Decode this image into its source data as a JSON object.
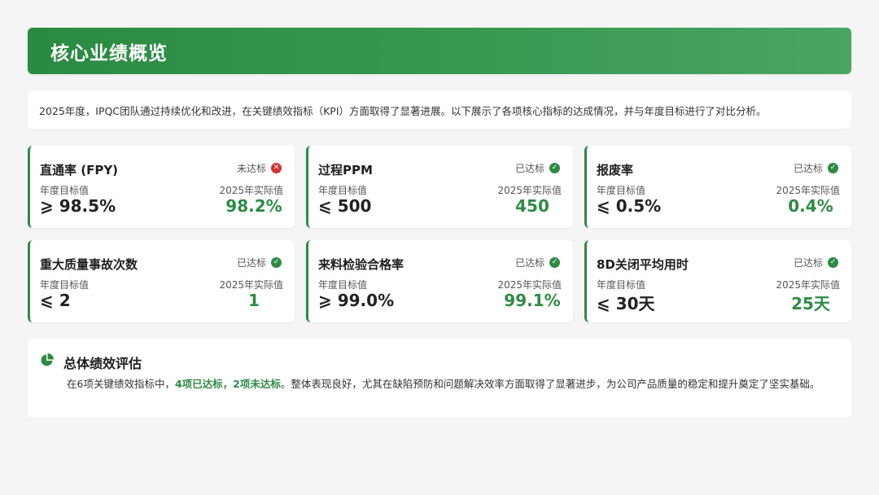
{
  "header": {
    "title": "核心业绩概览"
  },
  "intro": {
    "text": "2025年度，IPQC团队通过持续优化和改进，在关键绩效指标（KPI）方面取得了显著进展。以下展示了各项核心指标的达成情况，并与年度目标进行了对比分析。"
  },
  "labels": {
    "target": "年度目标值",
    "actual": "2025年实际值"
  },
  "kpis": [
    {
      "title": "直通率 (FPY)",
      "status": "未达标",
      "status_icon": "x-circle-icon",
      "target": "⩾ 98.5%",
      "actual": "98.2%"
    },
    {
      "title": "过程PPM",
      "status": "已达标",
      "status_icon": "check-circle-icon",
      "target": "⩽ 500",
      "actual": "450"
    },
    {
      "title": "报废率",
      "status": "已达标",
      "status_icon": "check-circle-icon",
      "target": "⩽ 0.5%",
      "actual": "0.4%"
    },
    {
      "title": "重大质量事故次数",
      "status": "已达标",
      "status_icon": "check-circle-icon",
      "target": "⩽ 2",
      "actual": "1"
    },
    {
      "title": "来料检验合格率",
      "status": "已达标",
      "status_icon": "check-circle-icon",
      "target": "⩾ 99.0%",
      "actual": "99.1%"
    },
    {
      "title": "8D关闭平均用时",
      "status": "已达标",
      "status_icon": "check-circle-icon",
      "target": "⩽ 30天",
      "actual": "25天"
    }
  ],
  "summary": {
    "title": "总体绩效评估",
    "icon": "pie-chart-icon",
    "text_before": "在6项关键绩效指标中，",
    "highlight": "4项已达标，2项未达标",
    "text_after": "。整体表现良好，尤其在缺陷预防和问题解决效率方面取得了显著进步，为公司产品质量的稳定和提升奠定了坚实基础。"
  },
  "colors": {
    "accent": "#2e8b45",
    "fail": "#d63030",
    "background": "#f5f5f5"
  }
}
